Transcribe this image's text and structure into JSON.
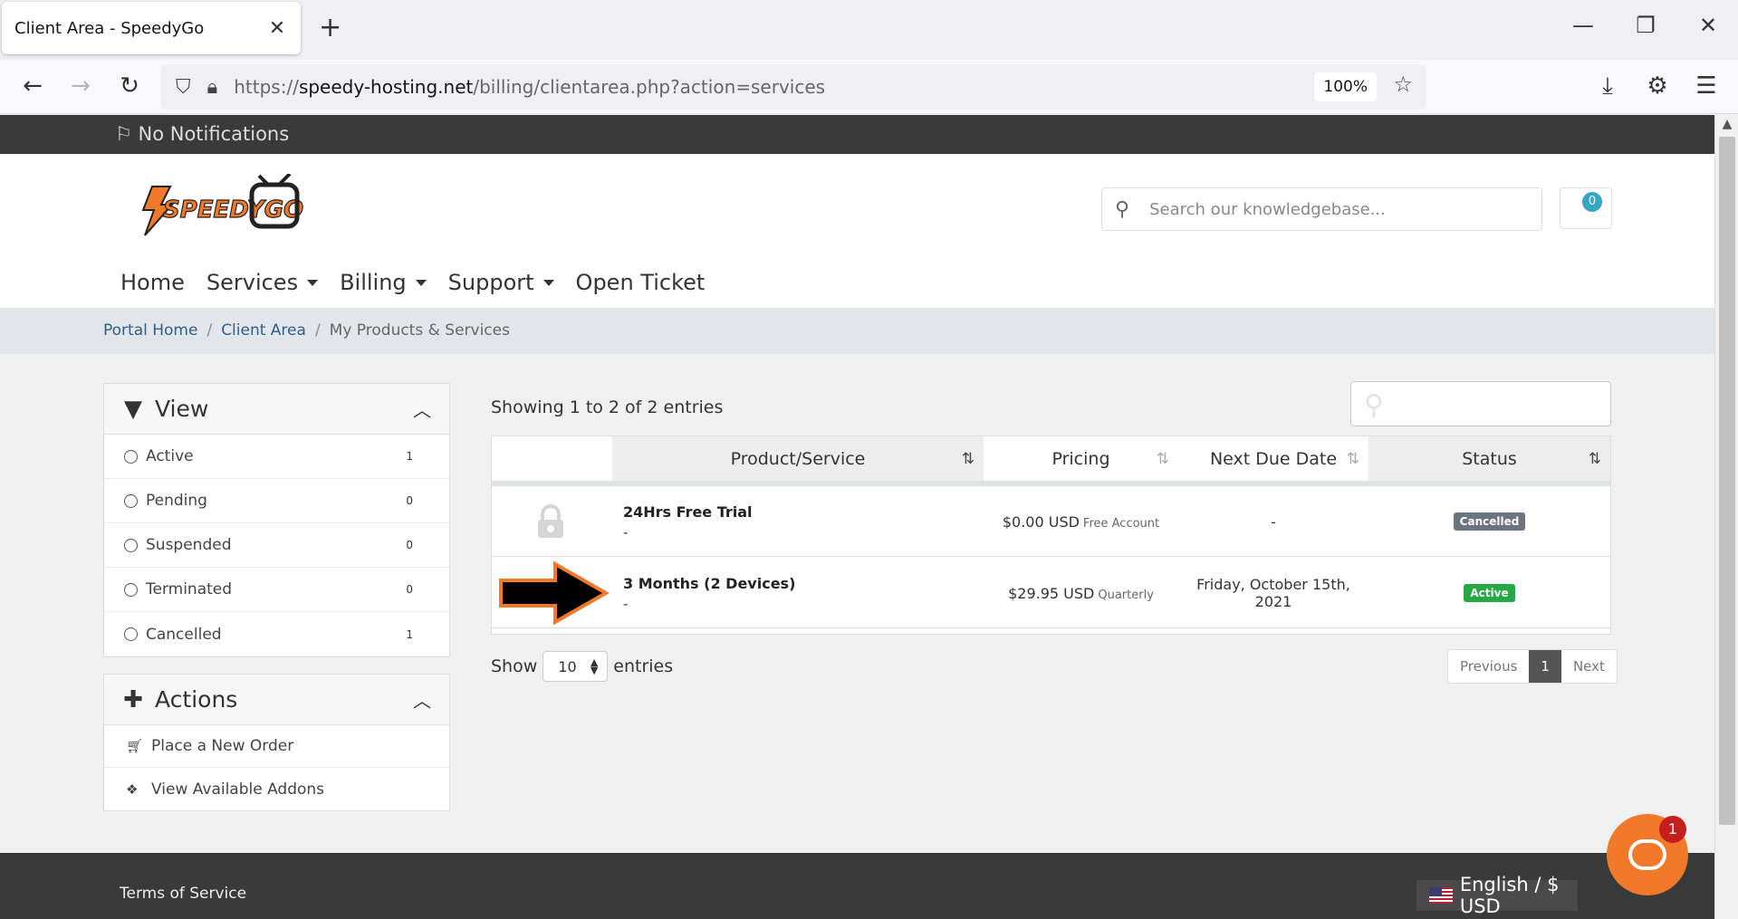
{
  "browser": {
    "tab_title": "Client Area - SpeedyGo",
    "url_prefix": "https://",
    "url_host": "speedy-hosting.net",
    "url_path": "/billing/clientarea.php?action=services",
    "zoom": "100%"
  },
  "topbar": {
    "notifications": "No Notifications"
  },
  "header": {
    "logo_text": "SPEEDYGO",
    "search_placeholder": "Search our knowledgebase...",
    "cart_count": "0"
  },
  "nav": {
    "home": "Home",
    "services": "Services",
    "billing": "Billing",
    "support": "Support",
    "open_ticket": "Open Ticket"
  },
  "breadcrumb": {
    "portal_home": "Portal Home",
    "client_area": "Client Area",
    "current": "My Products & Services"
  },
  "sidebar": {
    "view_title": "View",
    "filters": [
      {
        "label": "Active",
        "count": "1"
      },
      {
        "label": "Pending",
        "count": "0"
      },
      {
        "label": "Suspended",
        "count": "0"
      },
      {
        "label": "Terminated",
        "count": "0"
      },
      {
        "label": "Cancelled",
        "count": "1"
      }
    ],
    "actions_title": "Actions",
    "actions": [
      {
        "label": "Place a New Order"
      },
      {
        "label": "View Available Addons"
      }
    ]
  },
  "table": {
    "showing": "Showing 1 to 2 of 2 entries",
    "columns": [
      "Product/Service",
      "Pricing",
      "Next Due Date",
      "Status"
    ],
    "rows": [
      {
        "product": "24Hrs Free Trial",
        "domain": "-",
        "price": "$0.00 USD",
        "cycle": "Free Account",
        "due": "-",
        "status": "Cancelled",
        "status_color": "#6c757d"
      },
      {
        "product": "3 Months (2 Devices)",
        "domain": "-",
        "price": "$29.95 USD",
        "cycle": "Quarterly",
        "due": "Friday, October 15th, 2021",
        "status": "Active",
        "status_color": "#28a745"
      }
    ],
    "length_label_pre": "Show",
    "length_value": "10",
    "length_label_post": "entries",
    "pager": {
      "previous": "Previous",
      "current": "1",
      "next": "Next"
    }
  },
  "footer": {
    "terms": "Terms of Service",
    "language": "English / $ USD"
  },
  "chat": {
    "unread": "1"
  },
  "colors": {
    "topbar": "#3a3a3a",
    "accent_orange": "#f07a2a",
    "link": "#2d5f8a",
    "cart_badge": "#35a7c4"
  }
}
